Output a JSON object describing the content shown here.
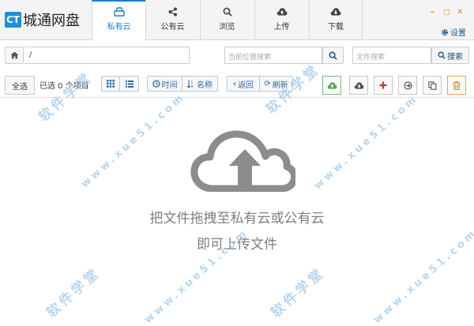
{
  "brand": {
    "badge": "CT",
    "name": "城通网盘"
  },
  "nav": {
    "tabs": [
      {
        "label": "私有云",
        "icon": "drive-icon",
        "active": true
      },
      {
        "label": "公有云",
        "icon": "share-icon",
        "active": false
      },
      {
        "label": "浏览",
        "icon": "search-icon",
        "active": false
      },
      {
        "label": "上传",
        "icon": "cloud-upload-icon",
        "active": false
      },
      {
        "label": "下载",
        "icon": "cloud-download-icon",
        "active": false
      }
    ]
  },
  "window": {
    "minimize": "–",
    "maximize": "□",
    "close": "✕",
    "settings_label": "设置"
  },
  "path": {
    "value": "/",
    "location_search_placeholder": "当前位置搜索",
    "file_search_placeholder": "文件搜索",
    "search_label": "搜索"
  },
  "toolbar": {
    "select_all": "全选",
    "selected_text": "已选 0 个项目",
    "sort_time": "时间",
    "sort_name": "名称",
    "back": "返回",
    "refresh": "刷新"
  },
  "empty_state": {
    "line1": "把文件拖拽至私有云或公有云",
    "line2": "即可上传文件"
  },
  "watermark": {
    "text1": "软件学堂",
    "text2": "www.xue51.com"
  },
  "colors": {
    "accent": "#1c7fc6",
    "upload_green": "#5aa05a",
    "add_red": "#c0392b",
    "delete_orange": "#e0861c",
    "empty_gray": "#8c8c8c"
  }
}
